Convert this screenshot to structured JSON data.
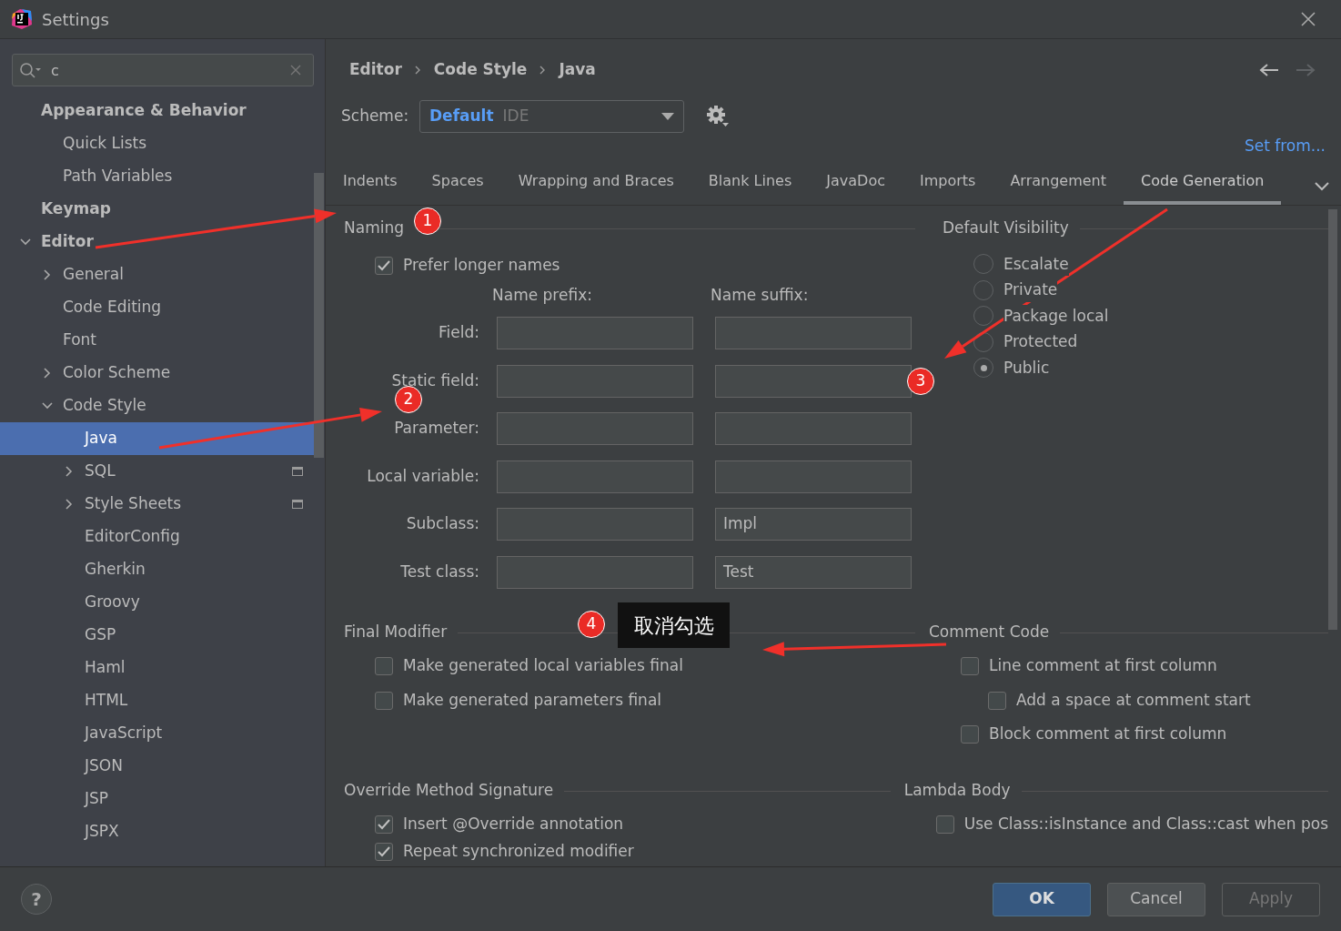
{
  "window": {
    "title": "Settings"
  },
  "search": {
    "value": "c"
  },
  "sidebar": {
    "items": [
      {
        "label": "Appearance & Behavior",
        "children": [
          {
            "label": "Quick Lists"
          },
          {
            "label": "Path Variables"
          }
        ]
      },
      {
        "label": "Keymap"
      },
      {
        "label": "Editor",
        "expanded": true,
        "children": [
          {
            "label": "General",
            "expanded": false
          },
          {
            "label": "Code Editing"
          },
          {
            "label": "Font"
          },
          {
            "label": "Color Scheme",
            "expanded": false
          },
          {
            "label": "Code Style",
            "expanded": true,
            "children": [
              {
                "label": "Java",
                "selected": true
              },
              {
                "label": "SQL",
                "expanded": false,
                "scope_icon": true
              },
              {
                "label": "Style Sheets",
                "expanded": false,
                "scope_icon": true
              },
              {
                "label": "EditorConfig"
              },
              {
                "label": "Gherkin"
              },
              {
                "label": "Groovy"
              },
              {
                "label": "GSP"
              },
              {
                "label": "Haml"
              },
              {
                "label": "HTML"
              },
              {
                "label": "JavaScript"
              },
              {
                "label": "JSON"
              },
              {
                "label": "JSP"
              },
              {
                "label": "JSPX"
              }
            ]
          }
        ]
      }
    ]
  },
  "breadcrumb": [
    "Editor",
    "Code Style",
    "Java"
  ],
  "scheme": {
    "label": "Scheme:",
    "name": "Default",
    "scope": "IDE"
  },
  "set_from": "Set from...",
  "tabs": [
    {
      "label": "Indents",
      "selected": false
    },
    {
      "label": "Spaces",
      "selected": false
    },
    {
      "label": "Wrapping and Braces",
      "selected": false
    },
    {
      "label": "Blank Lines",
      "selected": false
    },
    {
      "label": "JavaDoc",
      "selected": false
    },
    {
      "label": "Imports",
      "selected": false
    },
    {
      "label": "Arrangement",
      "selected": false
    },
    {
      "label": "Code Generation",
      "selected": true
    }
  ],
  "naming": {
    "title": "Naming",
    "prefer_longer": {
      "label": "Prefer longer names",
      "checked": true
    },
    "prefix_header": "Name prefix:",
    "suffix_header": "Name suffix:",
    "rows": [
      {
        "label": "Field:"
      },
      {
        "label": "Static field:"
      },
      {
        "label": "Parameter:"
      },
      {
        "label": "Local variable:"
      },
      {
        "label": "Subclass:",
        "suffix": "Impl"
      },
      {
        "label": "Test class:",
        "suffix": "Test"
      }
    ]
  },
  "default_visibility": {
    "title": "Default Visibility",
    "options": [
      {
        "label": "Escalate",
        "selected": false
      },
      {
        "label": "Private",
        "selected": false
      },
      {
        "label": "Package local",
        "selected": false
      },
      {
        "label": "Protected",
        "selected": false
      },
      {
        "label": "Public",
        "selected": true
      }
    ]
  },
  "final_modifier": {
    "title": "Final Modifier",
    "options": [
      {
        "label": "Make generated local variables final",
        "checked": false
      },
      {
        "label": "Make generated parameters final",
        "checked": false
      }
    ]
  },
  "comment_code": {
    "title": "Comment Code",
    "options": [
      {
        "label": "Line comment at first column",
        "checked": false,
        "children": [
          {
            "label": "Add a space at comment start",
            "checked": false
          }
        ]
      },
      {
        "label": "Block comment at first column",
        "checked": false
      }
    ]
  },
  "override_method_signature": {
    "title": "Override Method Signature",
    "options": [
      {
        "label": "Insert @Override annotation",
        "checked": true
      },
      {
        "label": "Repeat synchronized modifier",
        "checked": true
      }
    ]
  },
  "lambda_body": {
    "title": "Lambda Body",
    "options": [
      {
        "label": "Use Class::isInstance and Class::cast when pos",
        "checked": false
      }
    ]
  },
  "help": "?",
  "buttons": [
    {
      "label": "OK",
      "kind": "default"
    },
    {
      "label": "Cancel",
      "kind": "normal"
    },
    {
      "label": "Apply",
      "kind": "disabled"
    }
  ],
  "annotations": {
    "badges": [
      "1",
      "2",
      "3",
      "4"
    ],
    "label": "取消勾选"
  }
}
